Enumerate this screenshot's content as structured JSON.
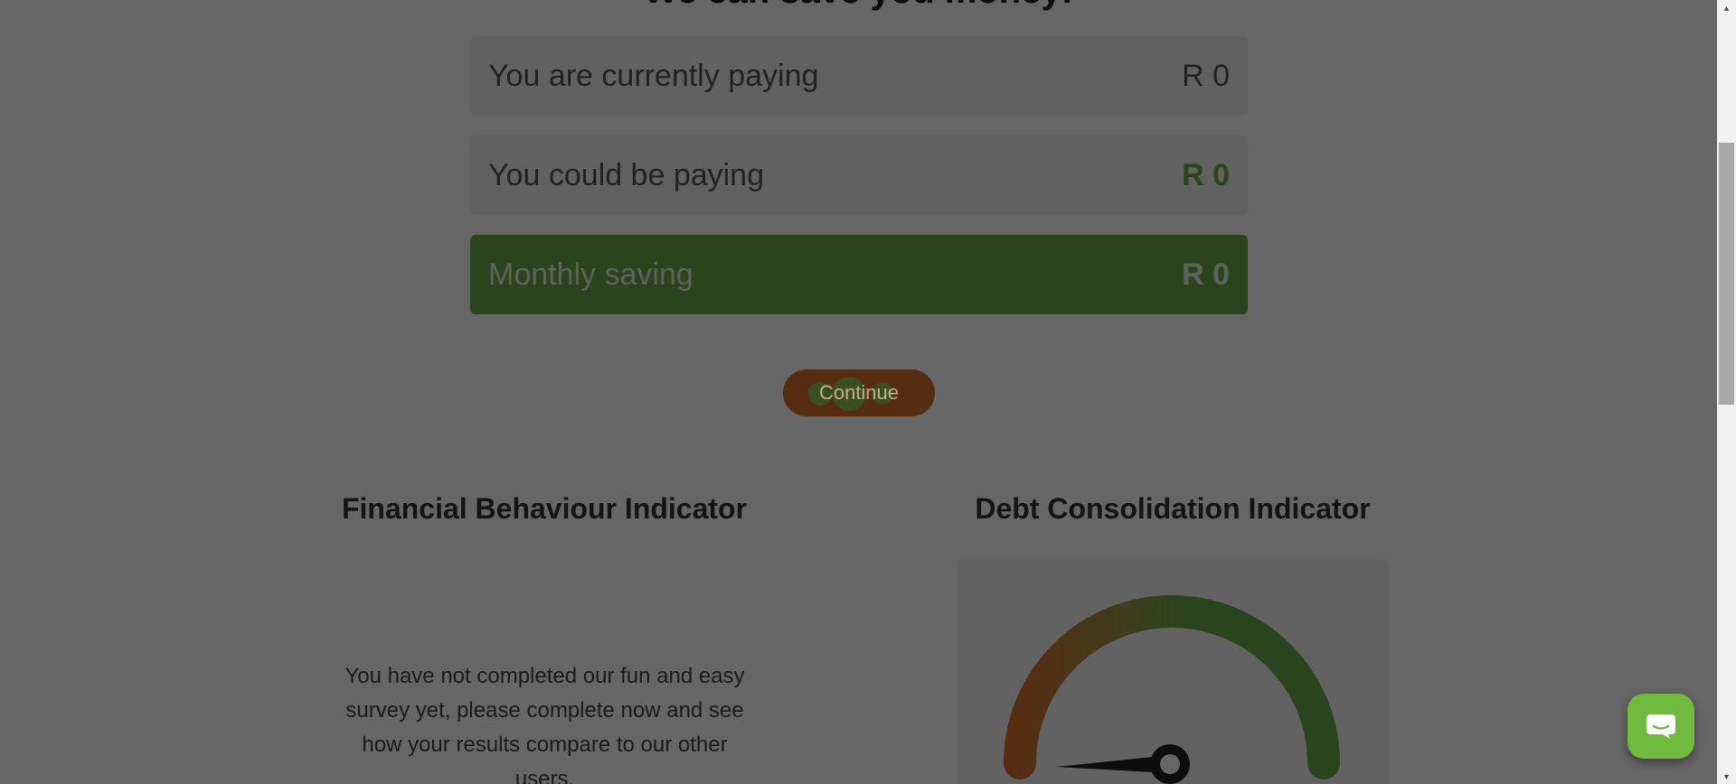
{
  "savings": {
    "heading": "We can save you money!",
    "current_label": "You are currently paying",
    "current_value": "R 0",
    "could_label": "You could be paying",
    "could_value": "R 0",
    "monthly_label": "Monthly saving",
    "monthly_value": "R 0",
    "continue_label": "Continue"
  },
  "financial_behaviour": {
    "title": "Financial Behaviour Indicator",
    "message": "You have not completed our fun and easy survey yet, please complete now and see how your results compare to our other users."
  },
  "debt_consolidation": {
    "title": "Debt Consolidation Indicator"
  },
  "colors": {
    "accent_green": "#6aab4a",
    "button_orange": "#d9712e",
    "gauge_start": "#d9712e",
    "gauge_end": "#6aab4a"
  },
  "icons": {
    "chat": "chat-bubble-icon"
  }
}
